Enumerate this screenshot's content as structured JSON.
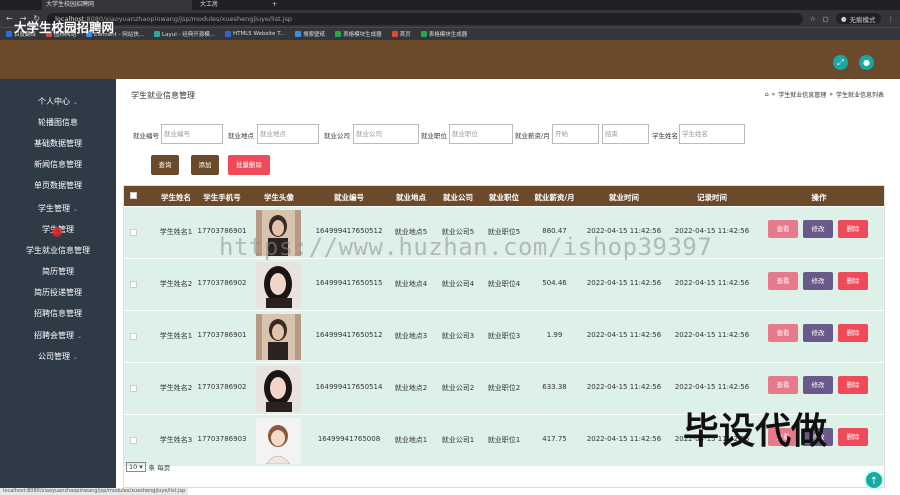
{
  "browser": {
    "tabs": [
      "大学生校园招聘网",
      "大工房",
      "+"
    ],
    "url_host": "localhost",
    "url_rest": ":8080/xiaoyuanzhaopinwang/jsp/modules/xueshengjiuye/list.jsp",
    "profile_label": "无痕模式",
    "bookmarks": [
      "百度翻译",
      "图标网站",
      "Element - 网站快...",
      "Layui - 经典开源模...",
      "HTML5 Website T...",
      "搜索壁纸",
      "表格模块生成器",
      "首页",
      "表格模块生成器"
    ]
  },
  "app": {
    "title": "大学生校园招聘网"
  },
  "sidebar": {
    "items": [
      "个人中心",
      "轮播图信息",
      "基础数据管理",
      "新闻信息管理",
      "单页数据管理",
      "学生管理",
      "学生管理",
      "学生就业信息管理",
      "简历管理",
      "简历投递管理",
      "招聘信息管理",
      "招聘会管理",
      "公司管理"
    ]
  },
  "page": {
    "title": "学生就业信息管理",
    "breadcrumb": [
      "学生就业信息管理",
      "学生就业信息列表"
    ]
  },
  "filters": {
    "labels": [
      "就业编号",
      "就业地点",
      "就业公司",
      "就业职位",
      "就业薪资/月",
      "学生姓名"
    ],
    "placeholders": [
      "就业编号",
      "就业地点",
      "就业公司",
      "就业职位",
      "开始",
      "结束",
      "学生姓名"
    ],
    "search_button": "查询",
    "add_button": "添加",
    "batch_delete_button": "批量删除"
  },
  "table": {
    "headers": [
      "学生姓名",
      "学生手机号",
      "学生头像",
      "就业编号",
      "就业地点",
      "就业公司",
      "就业职位",
      "就业薪资/月",
      "就业时间",
      "记录时间",
      "操作"
    ],
    "rows": [
      {
        "name": "学生姓名1",
        "phone": "17703786901",
        "code": "164999417650512",
        "place": "就业地点5",
        "company": "就业公司5",
        "position": "就业职位5",
        "salary": "860.47",
        "job_time": "2022-04-15 11:42:56",
        "record_time": "2022-04-15 11:42:56"
      },
      {
        "name": "学生姓名2",
        "phone": "17703786902",
        "code": "164999417650515",
        "place": "就业地点4",
        "company": "就业公司4",
        "position": "就业职位4",
        "salary": "504.46",
        "job_time": "2022-04-15 11:42:56",
        "record_time": "2022-04-15 11:42:56"
      },
      {
        "name": "学生姓名1",
        "phone": "17703786901",
        "code": "164999417650512",
        "place": "就业地点3",
        "company": "就业公司3",
        "position": "就业职位3",
        "salary": "1.99",
        "job_time": "2022-04-15 11:42:56",
        "record_time": "2022-04-15 11:42:56"
      },
      {
        "name": "学生姓名2",
        "phone": "17703786902",
        "code": "164999417650514",
        "place": "就业地点2",
        "company": "就业公司2",
        "position": "就业职位2",
        "salary": "633.38",
        "job_time": "2022-04-15 11:42:56",
        "record_time": "2022-04-15 11:42:56"
      },
      {
        "name": "学生姓名3",
        "phone": "17703786903",
        "code": "16499941765008",
        "place": "就业地点1",
        "company": "就业公司1",
        "position": "就业职位1",
        "salary": "417.75",
        "job_time": "2022-04-15 11:42:56",
        "record_time": "2022-04-15 11:42:56"
      }
    ],
    "actions": [
      "查看",
      "修改",
      "删除"
    ]
  },
  "pager": {
    "page_size": "10",
    "suffix": "条 每页"
  },
  "watermark": "https://www.huzhan.com/ishop39397",
  "overlay_text": "毕设代做",
  "status_url": "localhost:8080/xiaoyuanzhaopinwang/jsp/modules/xueshengjiuye/list.jsp",
  "colors": {
    "header_brown": "#6b4a2b",
    "sidebar": "#2f3a47",
    "row_green": "#ddf1e8",
    "view_btn": "#e77a8a",
    "edit_btn": "#6a5a8c",
    "delete_btn": "#ef4a5a",
    "teal": "#1aa8a2"
  }
}
